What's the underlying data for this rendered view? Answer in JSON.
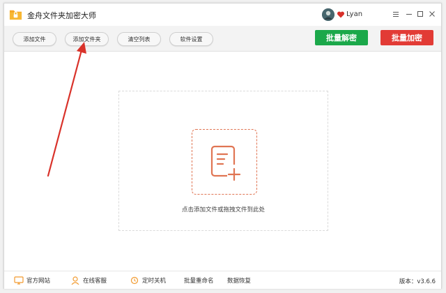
{
  "app": {
    "title": "金舟文件夹加密大师",
    "username": "Lyan"
  },
  "toolbar": {
    "add_file": "添加文件",
    "add_folder": "添加文件夹",
    "clear_list": "清空列表",
    "settings": "软件设置",
    "batch_decrypt": "批量解密",
    "batch_encrypt": "批量加密"
  },
  "dropzone": {
    "hint": "点击添加文件或拖拽文件到此处"
  },
  "statusbar": {
    "website": "官方网站",
    "support": "在线客服",
    "shutdown": "定时关机",
    "rename": "批量重命名",
    "recovery": "数据恢复",
    "version": "版本：v3.6.6"
  },
  "colors": {
    "decrypt_green": "#1ba84a",
    "encrypt_red": "#e23b35",
    "accent_orange": "#e07553",
    "arrow_red": "#d9322a"
  },
  "icons": {
    "logo": "folder-lock-icon",
    "heart": "heart-icon",
    "menu": "menu-icon",
    "minimize": "minimize-icon",
    "maximize": "maximize-icon",
    "close": "close-icon",
    "add_document": "add-document-icon",
    "website": "monitor-icon",
    "support": "headset-icon",
    "shutdown": "clock-icon"
  }
}
